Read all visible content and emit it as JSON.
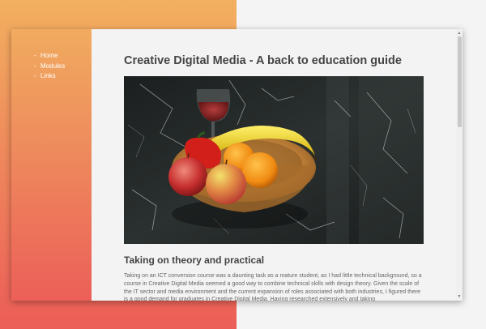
{
  "nav": {
    "items": [
      {
        "label": "Home"
      },
      {
        "label": "Modules"
      },
      {
        "label": "Links"
      }
    ]
  },
  "main": {
    "title": "Creative Digital Media - A back to education guide",
    "section_heading": "Taking on theory and practical",
    "paragraph": "Taking on an ICT conversion course was a daunting task as a mature student, as I had little technical background, so a course in Creative Digital Media seemed a good way to combine technical skills with design theory. Given the scale of the IT sector and media environment and the current expansion of roles associated with both industries, I figured there is a good demand for graduates in Creative Digital Media. Having researched extensively and taking"
  },
  "colors": {
    "gradient_top": "#f2b05f",
    "gradient_bottom": "#ec5d58",
    "title_text": "#444444",
    "body_text": "#666666"
  },
  "icons": {
    "scroll_up": "scroll-up-arrow-icon",
    "scroll_down": "scroll-down-arrow-icon"
  }
}
